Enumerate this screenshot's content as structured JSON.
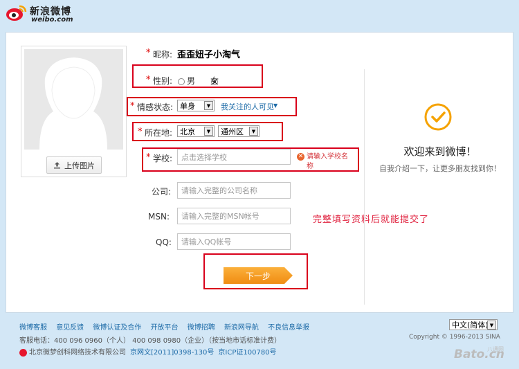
{
  "header": {
    "logo_cn": "新浪微博",
    "logo_en": "weibo.com"
  },
  "avatar": {
    "upload_label": "上传图片"
  },
  "form": {
    "nickname": {
      "label": "昵称:",
      "value": "歪歪妞子小淘气"
    },
    "gender": {
      "label": "性别:",
      "options": [
        "男",
        "女"
      ],
      "selected": "女"
    },
    "relationship": {
      "label": "情感状态:",
      "value": "单身",
      "visibility": "我关注的人可见"
    },
    "location": {
      "label": "所在地:",
      "province": "北京",
      "district": "通州区"
    },
    "school": {
      "label": "学校:",
      "placeholder": "点击选择学校",
      "error": "请输入学校名称"
    },
    "company": {
      "label": "公司:",
      "placeholder": "请输入完整的公司名称"
    },
    "msn": {
      "label": "MSN:",
      "placeholder": "请输入完整的MSN帐号"
    },
    "qq": {
      "label": "QQ:",
      "placeholder": "请输入QQ帐号"
    },
    "next_label": "下一步"
  },
  "note": "完整填写资料后就能提交了",
  "welcome": {
    "title": "欢迎来到微博！",
    "intro": "自我介绍一下，让更多朋友找到你！"
  },
  "footer": {
    "links": [
      "微博客服",
      "意见反馈",
      "微博认证及合作",
      "开放平台",
      "微博招聘",
      "新浪网导航",
      "不良信息举报"
    ],
    "phone": "客服电话：400 096 0960（个人） 400 098 0980（企业）（按当地市话标准计费）",
    "company": "北京微梦创科网络技术有限公司",
    "license1": "京网文[2011]0398-130号",
    "license2": "京ICP证100780号",
    "language": "中文(简体)",
    "copyright": "Copyright © 1996-2013 SINA",
    "watermark": "Bato.cn",
    "watermark_top": "八通网"
  },
  "colors": {
    "accent": "#f08c12",
    "highlight_box": "#d9001b",
    "link": "#1f6ca8",
    "background": "#d3e7f6"
  }
}
